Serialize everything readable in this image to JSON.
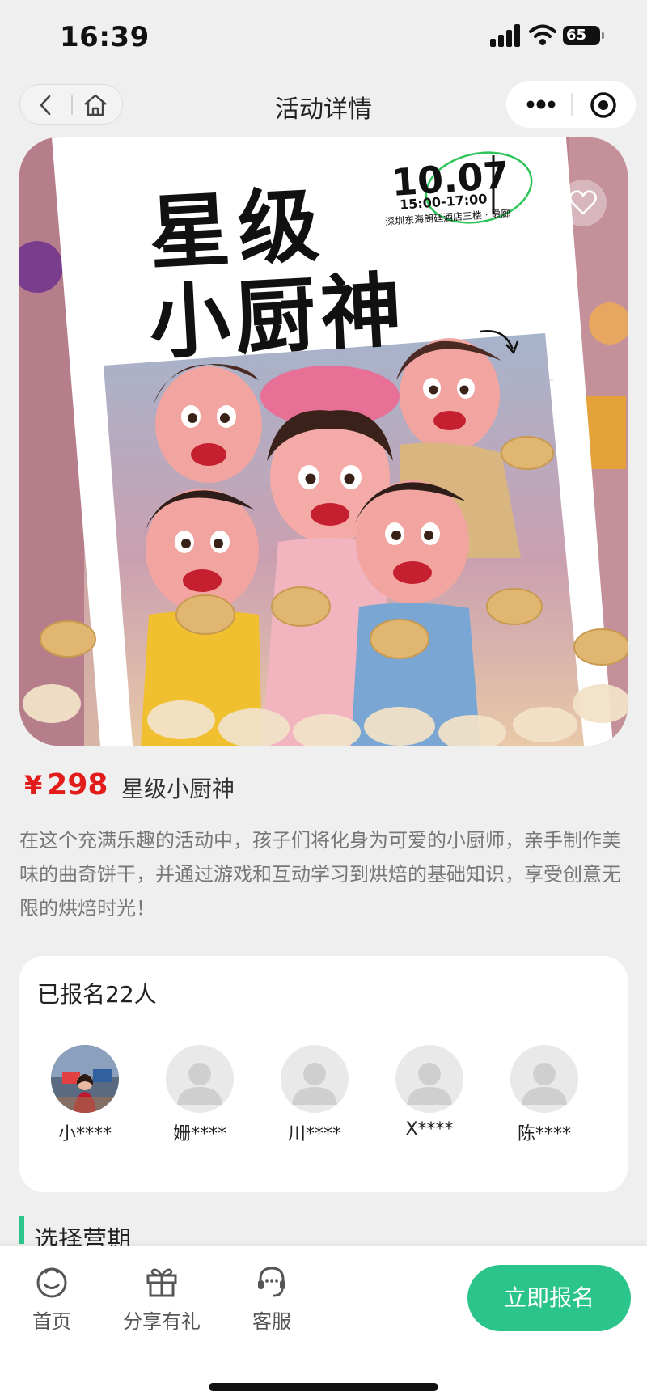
{
  "status_bar": {
    "time": "16:39",
    "battery": "65"
  },
  "nav": {
    "title": "活动详情"
  },
  "hero": {
    "poster_title_line1": "星级",
    "poster_title_line2": "小厨神",
    "poster_date": "10.07",
    "poster_time": "15:00-17:00",
    "poster_venue": "深圳东海朗廷酒店三楼 · 爵廊"
  },
  "product": {
    "currency": "¥",
    "price": "298",
    "name": "星级小厨神",
    "description": "在这个充满乐趣的活动中，孩子们将化身为可爱的小厨师，亲手制作美味的曲奇饼干，并通过游戏和互动学习到烘焙的基础知识，享受创意无限的烘焙时光！"
  },
  "signup": {
    "title": "已报名22人",
    "attendees": [
      {
        "name": "小****",
        "avatar": "photo"
      },
      {
        "name": "姗****",
        "avatar": "default-user-icon"
      },
      {
        "name": "川****",
        "avatar": "default-user-icon"
      },
      {
        "name": "X****",
        "avatar": "default-user-icon"
      },
      {
        "name": "陈****",
        "avatar": "default-user-icon"
      }
    ]
  },
  "section": {
    "title": "选择营期"
  },
  "bottom_bar": {
    "tabs": [
      {
        "label": "首页",
        "icon": "home-face-icon"
      },
      {
        "label": "分享有礼",
        "icon": "gift-icon"
      },
      {
        "label": "客服",
        "icon": "headset-icon"
      }
    ],
    "cta_label": "立即报名"
  },
  "colors": {
    "accent": "#2bc58b",
    "price": "#e21b1b",
    "background": "#efefef"
  }
}
